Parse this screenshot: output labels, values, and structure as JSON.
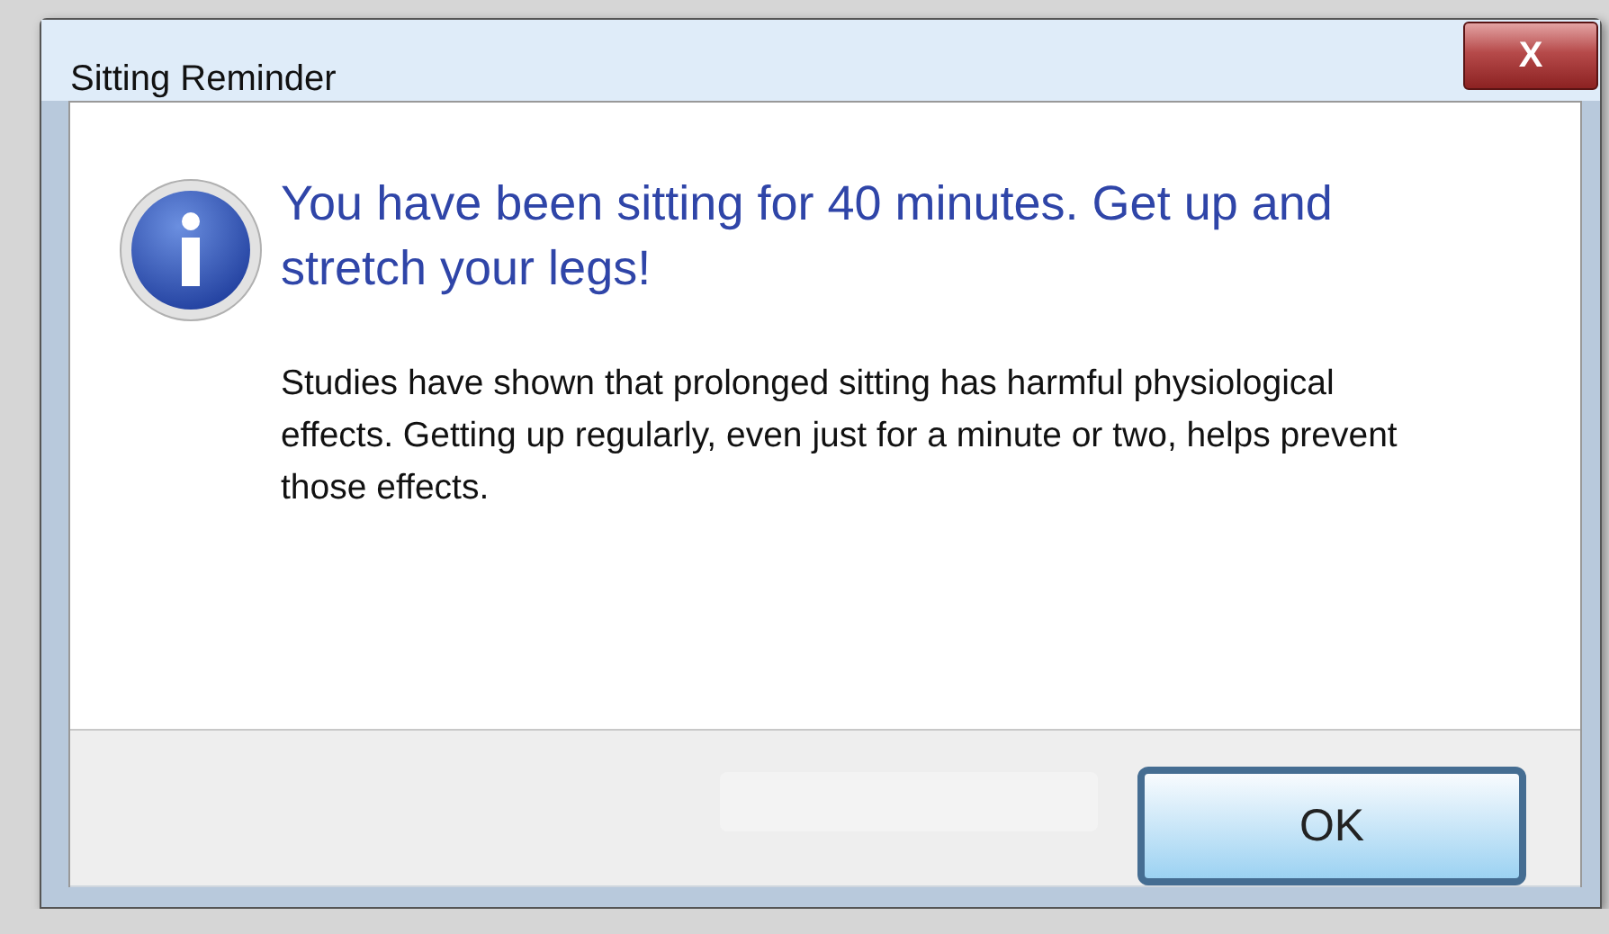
{
  "window": {
    "title": "Sitting Reminder",
    "close_button": "X"
  },
  "message": {
    "heading": "You have been sitting for 40 minutes. Get up and stretch your legs!",
    "body": "Studies have shown that prolonged sitting has harmful physiological effects. Getting up regularly, even just for a minute or two, helps prevent those effects."
  },
  "buttons": [
    {
      "label": "OK",
      "kind": "default"
    }
  ]
}
